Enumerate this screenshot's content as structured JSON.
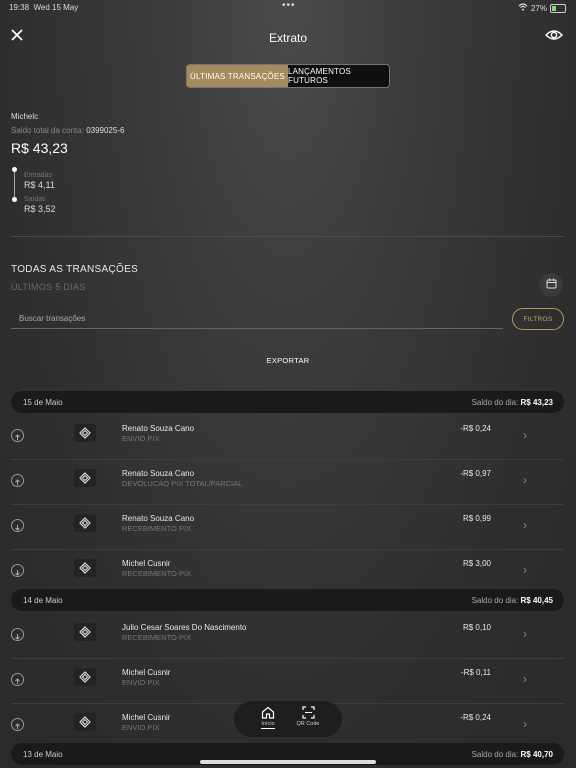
{
  "status": {
    "time": "19:38",
    "date": "Wed 15 May",
    "battery": "27%"
  },
  "header": {
    "title": "Extrato",
    "close_icon": "close-icon",
    "eye_icon": "eye-icon"
  },
  "tabs": [
    {
      "label": "ÚLTIMAS TRANSAÇÕES",
      "active": true
    },
    {
      "label": "LANÇAMENTOS FUTUROS",
      "active": false
    }
  ],
  "account": {
    "name": "Michelc",
    "balance_label": "Saldo total da conta:",
    "account_number": "0399025-6",
    "balance": "R$ 43,23",
    "entradas_label": "Entradas",
    "entradas_value": "R$ 4,11",
    "saidas_label": "Saídas",
    "saidas_value": "R$ 3,52"
  },
  "section": {
    "title": "TODAS AS TRANSAÇÕES",
    "subtitle": "ÚLTIMOS 5 DIAS",
    "search_placeholder": "Buscar transações",
    "filter_label": "FILTROS",
    "export_label": "EXPORTAR"
  },
  "days": [
    {
      "date": "15 de Maio",
      "balance_label": "Saldo do dia:",
      "balance": "R$ 43,23",
      "transactions": [
        {
          "direction": "out",
          "name": "Renato Souza Cano",
          "type": "ENVIO PIX",
          "amount": "-R$ 0,24"
        },
        {
          "direction": "out",
          "name": "Renato Souza Cano",
          "type": "DEVOLUCAO PIX TOTAL/PARCIAL",
          "amount": "-R$ 0,97"
        },
        {
          "direction": "in",
          "name": "Renato Souza Cano",
          "type": "RECEBIMENTO PIX",
          "amount": "R$ 0,99"
        },
        {
          "direction": "in",
          "name": "Michel Cusnir",
          "type": "RECEBIMENTO PIX",
          "amount": "R$ 3,00"
        }
      ]
    },
    {
      "date": "14 de Maio",
      "balance_label": "Saldo do dia:",
      "balance": "R$ 40,45",
      "transactions": [
        {
          "direction": "in",
          "name": "Julio Cesar Soares Do Nascimento",
          "type": "RECEBIMENTO PIX",
          "amount": "R$ 0,10"
        },
        {
          "direction": "out",
          "name": "Michel Cusnir",
          "type": "ENVIO PIX",
          "amount": "-R$ 0,11"
        },
        {
          "direction": "out",
          "name": "Michel Cusnir",
          "type": "ENVIO PIX",
          "amount": "-R$ 0,24"
        }
      ]
    },
    {
      "date": "13 de Maio",
      "balance_label": "Saldo do dia:",
      "balance": "R$ 40,70",
      "transactions": []
    }
  ],
  "bottom_nav": [
    {
      "label": "Início",
      "icon": "home-icon",
      "active": true
    },
    {
      "label": "QR Code",
      "icon": "qr-scan-icon",
      "active": false
    }
  ],
  "colors": {
    "accent": "#a48a5c",
    "filter_border": "#b4965c",
    "background": "#2e2e2e"
  }
}
